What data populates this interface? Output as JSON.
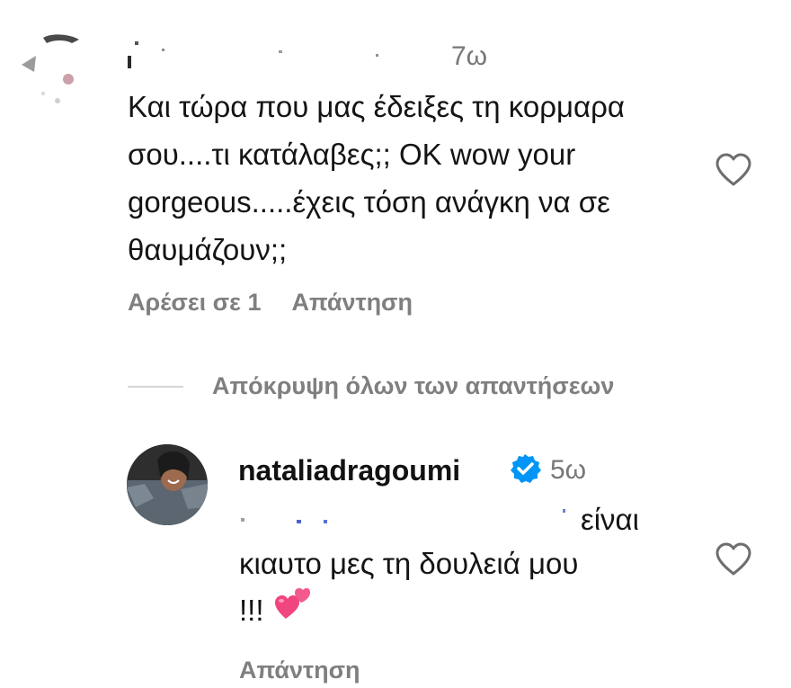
{
  "comment": {
    "time": "7ω",
    "text": "Και τώρα που μας έδειξες τη κορμαρα σου....τι κατάλαβες;; ΟΚ wow your gorgeous.....έχεις τόση ανάγκη να σε θαυμάζουν;;",
    "likes_label": "Αρέσει σε 1",
    "reply_label": "Απάντηση",
    "like_icon": "heart-outline-icon"
  },
  "replies_toggle": {
    "label": "Απόκρυψη όλων των απαντήσεων"
  },
  "reply": {
    "username": "nataliadragoumi",
    "verified_icon": "verified-badge-icon",
    "time": "5ω",
    "text_fragment_1": "είναι",
    "text_line_2": "κιαυτο μες τη δουλειά μου",
    "text_line_3": "!!!",
    "emoji_icon": "two-hearts-emoji",
    "reply_label": "Απάντηση",
    "like_icon": "heart-outline-icon"
  },
  "colors": {
    "secondary_text": "#7f7f7f",
    "primary_text": "#141414",
    "verified_blue": "#0095f6",
    "emoji_pink": "#f0457f"
  }
}
